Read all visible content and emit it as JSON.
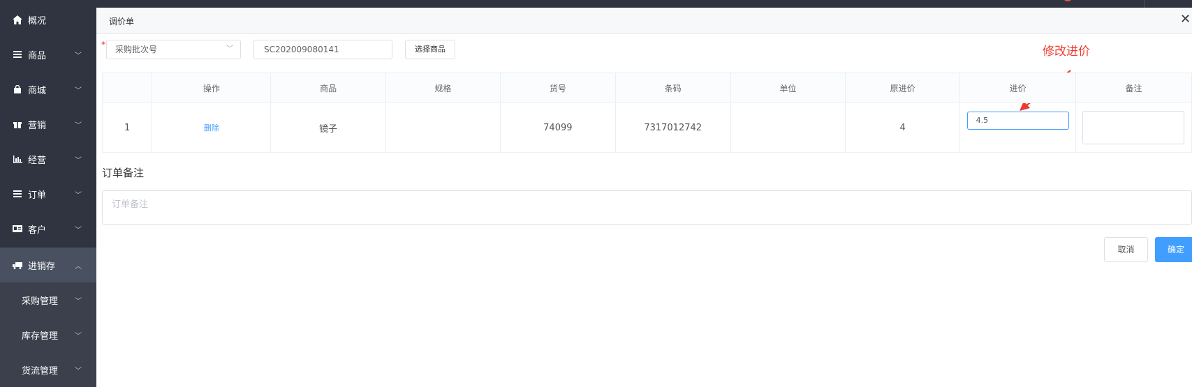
{
  "sidebar": {
    "items": [
      {
        "label": "概况",
        "icon": "home-icon",
        "chevron": ""
      },
      {
        "label": "商品",
        "icon": "list-icon",
        "chevron": "﹀"
      },
      {
        "label": "商城",
        "icon": "bag-icon",
        "chevron": "﹀"
      },
      {
        "label": "营销",
        "icon": "gift-icon",
        "chevron": "﹀"
      },
      {
        "label": "经营",
        "icon": "bar-chart-icon",
        "chevron": "﹀"
      },
      {
        "label": "订单",
        "icon": "list-icon",
        "chevron": "﹀"
      },
      {
        "label": "客户",
        "icon": "id-card-icon",
        "chevron": "﹀"
      },
      {
        "label": "进销存",
        "icon": "truck-icon",
        "chevron": "︿"
      }
    ],
    "sub_items": [
      {
        "label": "采购管理",
        "chevron": "﹀"
      },
      {
        "label": "库存管理",
        "chevron": "﹀"
      },
      {
        "label": "货流管理",
        "chevron": "﹀"
      }
    ]
  },
  "modal": {
    "title": "调价单",
    "close": "✕",
    "required_mark": "*",
    "select_value": "采购批次号",
    "select_chevron": "﹀",
    "batch_number": "SC202009080141",
    "select_product_button": "选择商品",
    "annotation": "修改进价"
  },
  "table": {
    "headers": [
      "",
      "操作",
      "商品",
      "规格",
      "货号",
      "条码",
      "单位",
      "原进价",
      "进价",
      "备注"
    ],
    "rows": [
      {
        "index": "1",
        "action": "删除",
        "product": "镜子",
        "spec": "",
        "sku": "74099",
        "barcode": "7317012742",
        "unit": "",
        "original_price": "4",
        "price": "4.5",
        "remark": ""
      }
    ]
  },
  "order_note": {
    "title": "订单备注",
    "placeholder": "订单备注"
  },
  "footer": {
    "cancel": "取消",
    "confirm": "确定"
  },
  "colors": {
    "sidebar_bg": "#2f3440",
    "sidebar_active": "#495060",
    "primary": "#409eff",
    "annotation": "#ee3a2e"
  }
}
